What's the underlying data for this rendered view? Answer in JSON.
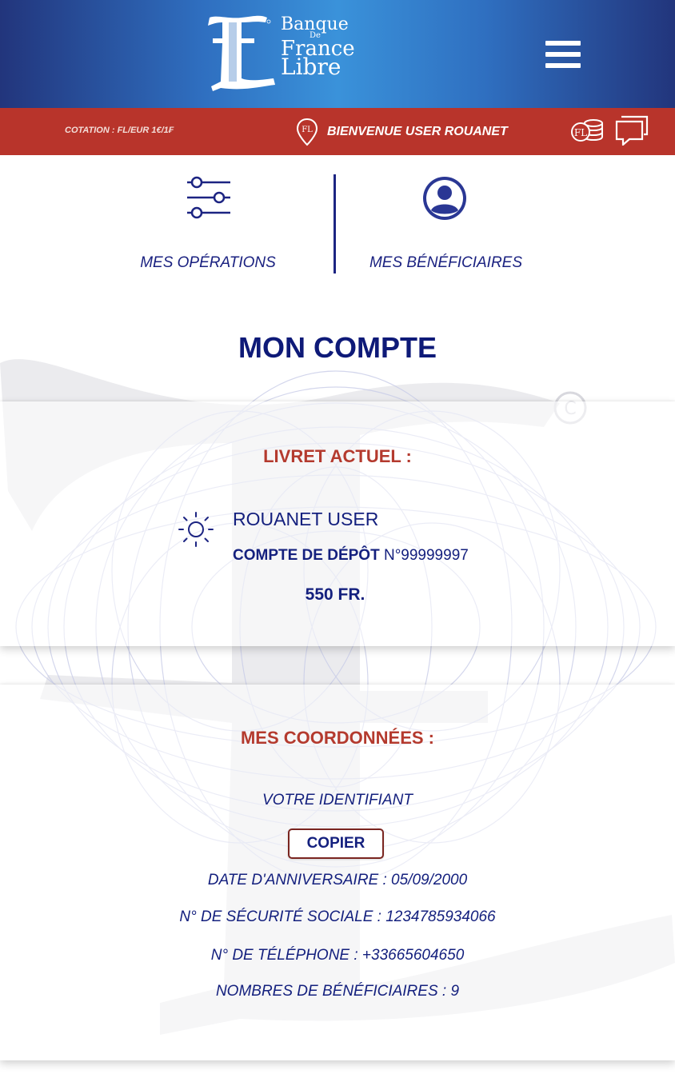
{
  "header": {
    "logo": {
      "line1": "Banque",
      "line2": "De",
      "line3": "France",
      "line4": "Libre",
      "icon": "fl-monogram-logo"
    },
    "menu_icon": "hamburger-menu-icon"
  },
  "topbar": {
    "cotation": "COTATION : FL/EUR 1€/1₣",
    "welcome": "BIENVENUE USER ROUANET",
    "icons": [
      "location-pin-icon",
      "coins-icon",
      "chat-icon"
    ]
  },
  "quicknav": {
    "operations_label": "MES OPÉRATIONS",
    "beneficiaries_label": "MES BÉNÉFICIAIRES"
  },
  "page_title": "MON COMPTE",
  "livret": {
    "heading": "LIVRET ACTUEL :",
    "name": "ROUANET USER",
    "type": "COMPTE DE DÉPÔT",
    "number": "N°99999997",
    "balance": "550 FR."
  },
  "coordonnees": {
    "heading": "MES COORDONNÉES :",
    "identifiant_label": "VOTRE IDENTIFIANT",
    "copy_button": "COPIER",
    "birthday": "DATE D'ANNIVERSAIRE : 05/09/2000",
    "ssn": "N° DE SÉCURITÉ SOCIALE : 1234785934066",
    "phone": "N° DE TÉLÉPHONE : +33665604650",
    "beneficiaries_count": "NOMBRES DE BÉNÉFICIAIRES : 9"
  },
  "colors": {
    "header_blue_dark": "#22357c",
    "header_blue_light": "#3a92da",
    "red_bar": "#b8342b",
    "navy_text": "#14207e",
    "heading_red": "#b43a2e"
  }
}
